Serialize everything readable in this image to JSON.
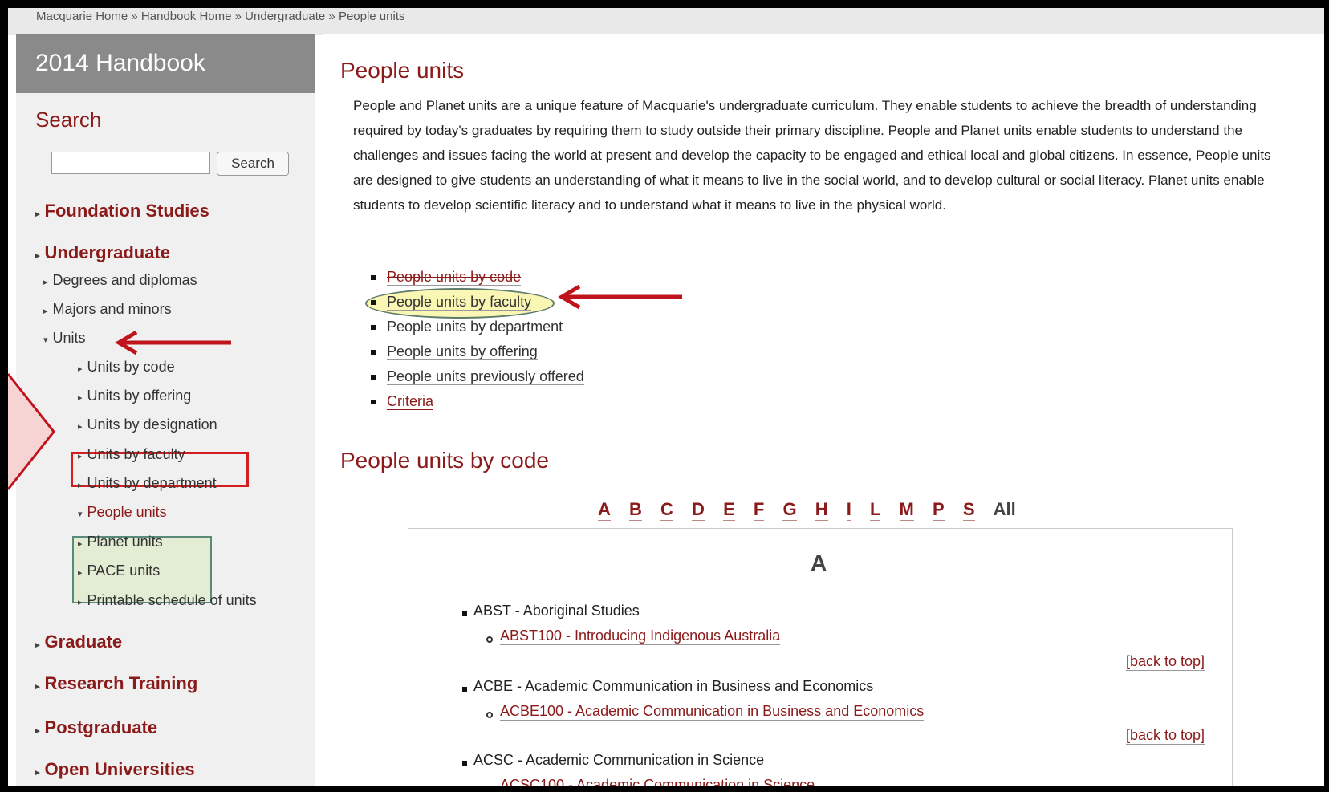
{
  "breadcrumb": {
    "items": [
      "Macquarie Home",
      "Handbook Home",
      "Undergraduate",
      "People units"
    ],
    "separator": "»"
  },
  "sidebar": {
    "title": "2014 Handbook",
    "search_heading": "Search",
    "search_placeholder": "",
    "search_button": "Search",
    "nav": {
      "foundation": "Foundation Studies",
      "undergraduate": "Undergraduate",
      "degrees": "Degrees and diplomas",
      "majors": "Majors and minors",
      "units": "Units",
      "units_by_code": "Units by code",
      "units_by_offering": "Units by offering",
      "units_by_designation": "Units by designation",
      "units_by_faculty": "Units by faculty",
      "units_by_department": "Units by department",
      "people_units": "People units",
      "planet_units": "Planet units",
      "pace_units": "PACE units",
      "printable_schedule": "Printable schedule of units",
      "graduate": "Graduate",
      "research_training": "Research Training",
      "postgraduate": "Postgraduate",
      "open_universities": "Open Universities"
    }
  },
  "main": {
    "title": "People units",
    "intro": "People and Planet units are a unique feature of Macquarie's undergraduate curriculum. They enable students to achieve the breadth of understanding required by today's graduates by requiring them to study outside their primary discipline. People and Planet units enable students to understand the challenges and issues facing the world at present and develop the capacity to be engaged and ethical local and global citizens. In essence, People units are designed to give students an understanding of what it means to live in the social world, and to develop cultural or social literacy. Planet units enable students to develop scientific literacy and to understand what it means to live in the physical world.",
    "links": [
      "People units by code",
      "People units by faculty",
      "People units by department",
      "People units by offering",
      "People units previously offered",
      "Criteria"
    ],
    "code_heading": "People units by code",
    "letters": [
      "A",
      "B",
      "C",
      "D",
      "E",
      "F",
      "G",
      "H",
      "I",
      "L",
      "M",
      "P",
      "S",
      "All"
    ],
    "section_letter": "A",
    "units": [
      {
        "head": "ABST - Aboriginal Studies",
        "link": "ABST100 - Introducing Indigenous Australia"
      },
      {
        "head": "ACBE - Academic Communication in Business and Economics",
        "link": "ACBE100 - Academic Communication in Business and Economics"
      },
      {
        "head": "ACSC - Academic Communication in Science",
        "link": "ACSC100 - Academic Communication in Science"
      }
    ],
    "back_to_top": "[back to top]"
  },
  "colors": {
    "brand_red": "#8b1a1a",
    "annotation_red": "#c0141c",
    "highlight_green": "#e2edd3",
    "highlight_yellow": "#faf7b5"
  }
}
